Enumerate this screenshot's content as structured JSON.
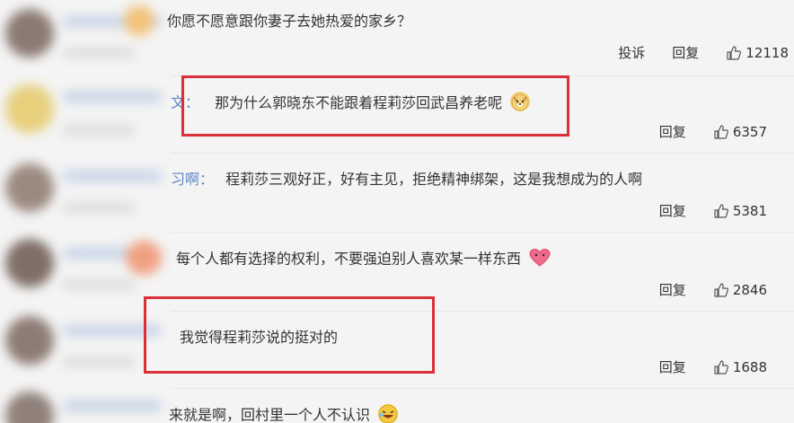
{
  "comments": [
    {
      "name_tail": "",
      "text": "你愿不愿意跟你妻子去她热爱的家乡？",
      "report_label": "投诉",
      "reply_label": "回复",
      "likes": "12118"
    },
    {
      "name_tail": "文：",
      "text": "那为什么郭晓东不能跟着程莉莎回武昌养老呢",
      "reply_label": "回复",
      "likes": "6357"
    },
    {
      "name_tail": "习啊：",
      "text": "程莉莎三观好正，好有主见，拒绝精神绑架，这是我想成为的人啊",
      "reply_label": "回复",
      "likes": "5381"
    },
    {
      "name_tail": "",
      "text": "每个人都有选择的权利，不要强迫别人喜欢某一样东西",
      "reply_label": "回复",
      "likes": "2846"
    },
    {
      "name_tail": "",
      "text": "我觉得程莉莎说的挺对的",
      "reply_label": "回复",
      "likes": "1688"
    },
    {
      "name_tail": "",
      "text": "来就是啊，回村里一个人不认识"
    }
  ],
  "colors": {
    "highlight_box": "#d9303a",
    "username_blue": "#5b86c2"
  },
  "icons": {
    "like": "thumbs-up-icon",
    "emoji_dog": "dog-face-emoji",
    "emoji_heart": "heart-emoji",
    "emoji_laugh": "laughing-emoji"
  }
}
